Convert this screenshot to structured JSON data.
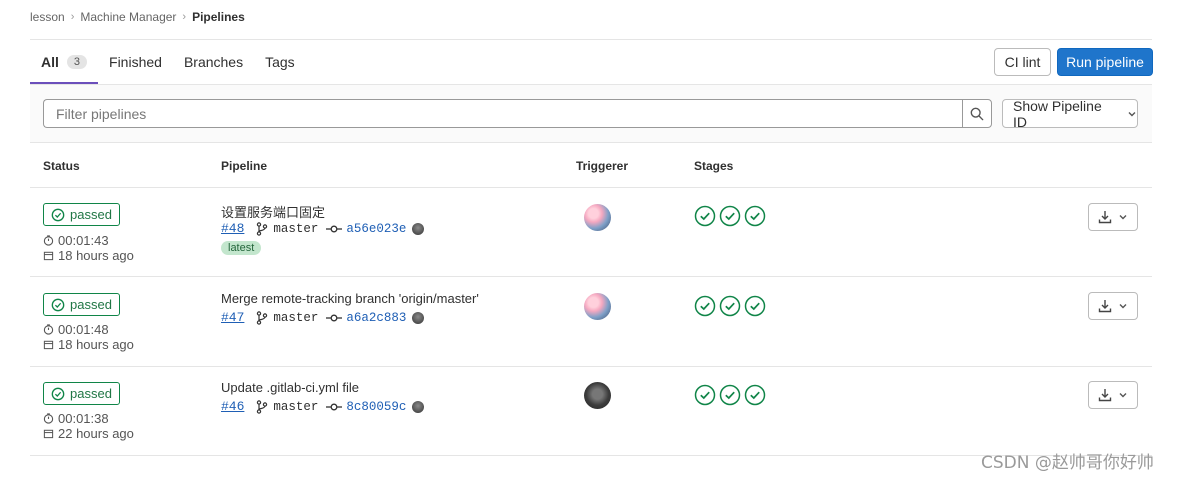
{
  "breadcrumb": [
    "lesson",
    "Machine Manager",
    "Pipelines"
  ],
  "tabs": [
    {
      "label": "All",
      "count": "3",
      "active": true
    },
    {
      "label": "Finished"
    },
    {
      "label": "Branches"
    },
    {
      "label": "Tags"
    }
  ],
  "actions": {
    "ci_lint": "CI lint",
    "run_pipeline": "Run pipeline"
  },
  "filter": {
    "placeholder": "Filter pipelines",
    "show_id_label": "Show Pipeline ID"
  },
  "columns": {
    "status": "Status",
    "pipeline": "Pipeline",
    "triggerer": "Triggerer",
    "stages": "Stages"
  },
  "pipelines": [
    {
      "status": "passed",
      "duration": "00:01:43",
      "finished": "18 hours ago",
      "title": "设置服务端口固定",
      "id": "#48",
      "branch": "master",
      "sha": "a56e023e",
      "latest_label": "latest",
      "triggerer_avatar": "pink-flowers-avatar",
      "stages": [
        "passed",
        "passed",
        "passed"
      ]
    },
    {
      "status": "passed",
      "duration": "00:01:48",
      "finished": "18 hours ago",
      "title": "Merge remote-tracking branch 'origin/master'",
      "id": "#47",
      "branch": "master",
      "sha": "a6a2c883",
      "triggerer_avatar": "pink-flowers-avatar",
      "stages": [
        "passed",
        "passed",
        "passed"
      ]
    },
    {
      "status": "passed",
      "duration": "00:01:38",
      "finished": "22 hours ago",
      "title": "Update .gitlab-ci.yml file",
      "id": "#46",
      "branch": "master",
      "sha": "8c80059c",
      "triggerer_avatar": "dark-photo-avatar",
      "stages": [
        "passed",
        "passed",
        "passed"
      ]
    }
  ],
  "watermark": "CSDN @赵帅哥你好帅",
  "colors": {
    "primary": "#1f75cb",
    "success": "#108548",
    "tab_active": "#6b4fbb",
    "link": "#1f5fb5"
  }
}
